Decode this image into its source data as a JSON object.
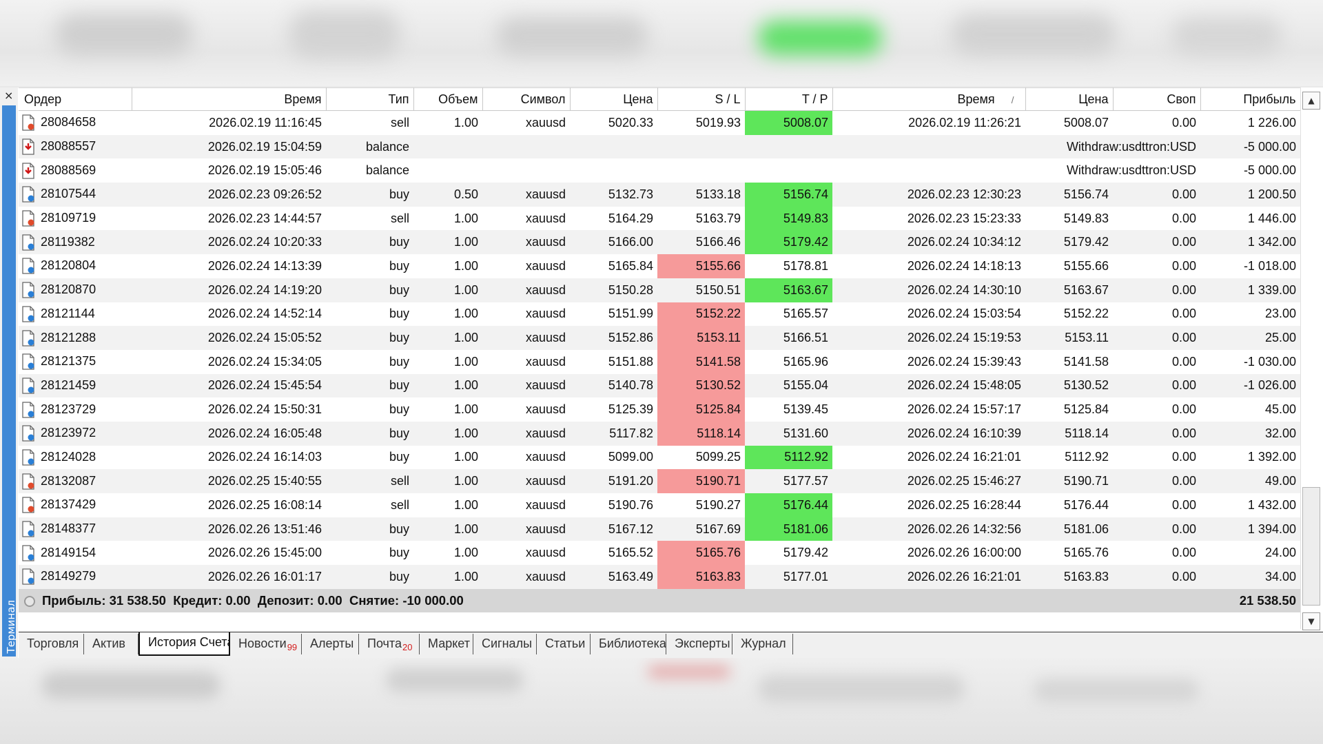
{
  "terminal": {
    "vertical_label": "Терминал",
    "close_symbol": "×"
  },
  "columns": [
    "Ордер",
    "Время",
    "Тип",
    "Объем",
    "Символ",
    "Цена",
    "S / L",
    "T / P",
    "Время",
    "Цена",
    "Своп",
    "Прибыль"
  ],
  "sort_indicator": "/",
  "rows": [
    {
      "order": "28084658",
      "icon": "sell",
      "open_time": "2026.02.19 11:16:45",
      "type": "sell",
      "volume": "1.00",
      "symbol": "xauusd",
      "price": "5020.33",
      "sl": "5019.93",
      "sl_hl": "",
      "tp": "5008.07",
      "tp_hl": "g",
      "close_time": "2026.02.19 11:26:21",
      "close_price": "5008.07",
      "swap": "0.00",
      "profit": "1 226.00"
    },
    {
      "order": "28088557",
      "icon": "balance",
      "open_time": "2026.02.19 15:04:59",
      "type": "balance",
      "comment": "Withdraw:usdttron:USD",
      "profit": "-5 000.00"
    },
    {
      "order": "28088569",
      "icon": "balance",
      "open_time": "2026.02.19 15:05:46",
      "type": "balance",
      "comment": "Withdraw:usdttron:USD",
      "profit": "-5 000.00"
    },
    {
      "order": "28107544",
      "icon": "buy",
      "open_time": "2026.02.23 09:26:52",
      "type": "buy",
      "volume": "0.50",
      "symbol": "xauusd",
      "price": "5132.73",
      "sl": "5133.18",
      "sl_hl": "",
      "tp": "5156.74",
      "tp_hl": "g",
      "close_time": "2026.02.23 12:30:23",
      "close_price": "5156.74",
      "swap": "0.00",
      "profit": "1 200.50"
    },
    {
      "order": "28109719",
      "icon": "sell",
      "open_time": "2026.02.23 14:44:57",
      "type": "sell",
      "volume": "1.00",
      "symbol": "xauusd",
      "price": "5164.29",
      "sl": "5163.79",
      "sl_hl": "",
      "tp": "5149.83",
      "tp_hl": "g",
      "close_time": "2026.02.23 15:23:33",
      "close_price": "5149.83",
      "swap": "0.00",
      "profit": "1 446.00"
    },
    {
      "order": "28119382",
      "icon": "buy",
      "open_time": "2026.02.24 10:20:33",
      "type": "buy",
      "volume": "1.00",
      "symbol": "xauusd",
      "price": "5166.00",
      "sl": "5166.46",
      "sl_hl": "",
      "tp": "5179.42",
      "tp_hl": "g",
      "close_time": "2026.02.24 10:34:12",
      "close_price": "5179.42",
      "swap": "0.00",
      "profit": "1 342.00"
    },
    {
      "order": "28120804",
      "icon": "buy",
      "open_time": "2026.02.24 14:13:39",
      "type": "buy",
      "volume": "1.00",
      "symbol": "xauusd",
      "price": "5165.84",
      "sl": "5155.66",
      "sl_hl": "r",
      "tp": "5178.81",
      "tp_hl": "",
      "close_time": "2026.02.24 14:18:13",
      "close_price": "5155.66",
      "swap": "0.00",
      "profit": "-1 018.00"
    },
    {
      "order": "28120870",
      "icon": "buy",
      "open_time": "2026.02.24 14:19:20",
      "type": "buy",
      "volume": "1.00",
      "symbol": "xauusd",
      "price": "5150.28",
      "sl": "5150.51",
      "sl_hl": "",
      "tp": "5163.67",
      "tp_hl": "g",
      "close_time": "2026.02.24 14:30:10",
      "close_price": "5163.67",
      "swap": "0.00",
      "profit": "1 339.00"
    },
    {
      "order": "28121144",
      "icon": "buy",
      "open_time": "2026.02.24 14:52:14",
      "type": "buy",
      "volume": "1.00",
      "symbol": "xauusd",
      "price": "5151.99",
      "sl": "5152.22",
      "sl_hl": "r",
      "tp": "5165.57",
      "tp_hl": "",
      "close_time": "2026.02.24 15:03:54",
      "close_price": "5152.22",
      "swap": "0.00",
      "profit": "23.00"
    },
    {
      "order": "28121288",
      "icon": "buy",
      "open_time": "2026.02.24 15:05:52",
      "type": "buy",
      "volume": "1.00",
      "symbol": "xauusd",
      "price": "5152.86",
      "sl": "5153.11",
      "sl_hl": "r",
      "tp": "5166.51",
      "tp_hl": "",
      "close_time": "2026.02.24 15:19:53",
      "close_price": "5153.11",
      "swap": "0.00",
      "profit": "25.00"
    },
    {
      "order": "28121375",
      "icon": "buy",
      "open_time": "2026.02.24 15:34:05",
      "type": "buy",
      "volume": "1.00",
      "symbol": "xauusd",
      "price": "5151.88",
      "sl": "5141.58",
      "sl_hl": "r",
      "tp": "5165.96",
      "tp_hl": "",
      "close_time": "2026.02.24 15:39:43",
      "close_price": "5141.58",
      "swap": "0.00",
      "profit": "-1 030.00"
    },
    {
      "order": "28121459",
      "icon": "buy",
      "open_time": "2026.02.24 15:45:54",
      "type": "buy",
      "volume": "1.00",
      "symbol": "xauusd",
      "price": "5140.78",
      "sl": "5130.52",
      "sl_hl": "r",
      "tp": "5155.04",
      "tp_hl": "",
      "close_time": "2026.02.24 15:48:05",
      "close_price": "5130.52",
      "swap": "0.00",
      "profit": "-1 026.00"
    },
    {
      "order": "28123729",
      "icon": "buy",
      "open_time": "2026.02.24 15:50:31",
      "type": "buy",
      "volume": "1.00",
      "symbol": "xauusd",
      "price": "5125.39",
      "sl": "5125.84",
      "sl_hl": "r",
      "tp": "5139.45",
      "tp_hl": "",
      "close_time": "2026.02.24 15:57:17",
      "close_price": "5125.84",
      "swap": "0.00",
      "profit": "45.00"
    },
    {
      "order": "28123972",
      "icon": "buy",
      "open_time": "2026.02.24 16:05:48",
      "type": "buy",
      "volume": "1.00",
      "symbol": "xauusd",
      "price": "5117.82",
      "sl": "5118.14",
      "sl_hl": "r",
      "tp": "5131.60",
      "tp_hl": "",
      "close_time": "2026.02.24 16:10:39",
      "close_price": "5118.14",
      "swap": "0.00",
      "profit": "32.00"
    },
    {
      "order": "28124028",
      "icon": "buy",
      "open_time": "2026.02.24 16:14:03",
      "type": "buy",
      "volume": "1.00",
      "symbol": "xauusd",
      "price": "5099.00",
      "sl": "5099.25",
      "sl_hl": "",
      "tp": "5112.92",
      "tp_hl": "g",
      "close_time": "2026.02.24 16:21:01",
      "close_price": "5112.92",
      "swap": "0.00",
      "profit": "1 392.00"
    },
    {
      "order": "28132087",
      "icon": "sell",
      "open_time": "2026.02.25 15:40:55",
      "type": "sell",
      "volume": "1.00",
      "symbol": "xauusd",
      "price": "5191.20",
      "sl": "5190.71",
      "sl_hl": "r",
      "tp": "5177.57",
      "tp_hl": "",
      "close_time": "2026.02.25 15:46:27",
      "close_price": "5190.71",
      "swap": "0.00",
      "profit": "49.00"
    },
    {
      "order": "28137429",
      "icon": "sell",
      "open_time": "2026.02.25 16:08:14",
      "type": "sell",
      "volume": "1.00",
      "symbol": "xauusd",
      "price": "5190.76",
      "sl": "5190.27",
      "sl_hl": "",
      "tp": "5176.44",
      "tp_hl": "g",
      "close_time": "2026.02.25 16:28:44",
      "close_price": "5176.44",
      "swap": "0.00",
      "profit": "1 432.00"
    },
    {
      "order": "28148377",
      "icon": "buy",
      "open_time": "2026.02.26 13:51:46",
      "type": "buy",
      "volume": "1.00",
      "symbol": "xauusd",
      "price": "5167.12",
      "sl": "5167.69",
      "sl_hl": "",
      "tp": "5181.06",
      "tp_hl": "g",
      "close_time": "2026.02.26 14:32:56",
      "close_price": "5181.06",
      "swap": "0.00",
      "profit": "1 394.00"
    },
    {
      "order": "28149154",
      "icon": "buy",
      "open_time": "2026.02.26 15:45:00",
      "type": "buy",
      "volume": "1.00",
      "symbol": "xauusd",
      "price": "5165.52",
      "sl": "5165.76",
      "sl_hl": "r",
      "tp": "5179.42",
      "tp_hl": "",
      "close_time": "2026.02.26 16:00:00",
      "close_price": "5165.76",
      "swap": "0.00",
      "profit": "24.00"
    },
    {
      "order": "28149279",
      "icon": "buy",
      "open_time": "2026.02.26 16:01:17",
      "type": "buy",
      "volume": "1.00",
      "symbol": "xauusd",
      "price": "5163.49",
      "sl": "5163.83",
      "sl_hl": "r",
      "tp": "5177.01",
      "tp_hl": "",
      "close_time": "2026.02.26 16:21:01",
      "close_price": "5163.83",
      "swap": "0.00",
      "profit": "34.00"
    }
  ],
  "summary": {
    "text": "Прибыль: 31 538.50  Кредит: 0.00  Депозит: 0.00  Снятие: -10 000.00",
    "total": "21 538.50"
  },
  "tabs": [
    {
      "label": "Торговля",
      "badge": "",
      "active": false
    },
    {
      "label": "Актив",
      "badge": "",
      "active": false
    },
    {
      "label": "История Счета",
      "badge": "",
      "active": true
    },
    {
      "label": "Новости",
      "badge": "99",
      "active": false
    },
    {
      "label": "Алерты",
      "badge": "",
      "active": false
    },
    {
      "label": "Почта",
      "badge": "20",
      "active": false
    },
    {
      "label": "Маркет",
      "badge": "",
      "active": false
    },
    {
      "label": "Сигналы",
      "badge": "",
      "active": false
    },
    {
      "label": "Статьи",
      "badge": "",
      "active": false
    },
    {
      "label": "Библиотека",
      "badge": "",
      "active": false
    },
    {
      "label": "Эксперты",
      "badge": "",
      "active": false
    },
    {
      "label": "Журнал",
      "badge": "",
      "active": false
    }
  ],
  "colors": {
    "tp_highlight": "#5ee65a",
    "sl_highlight": "#f69a9a",
    "sidebar": "#3f88d6",
    "badge": "#d41e1e"
  },
  "icons": {
    "buy": "order-buy-icon",
    "sell": "order-sell-icon",
    "balance": "balance-operation-icon"
  }
}
